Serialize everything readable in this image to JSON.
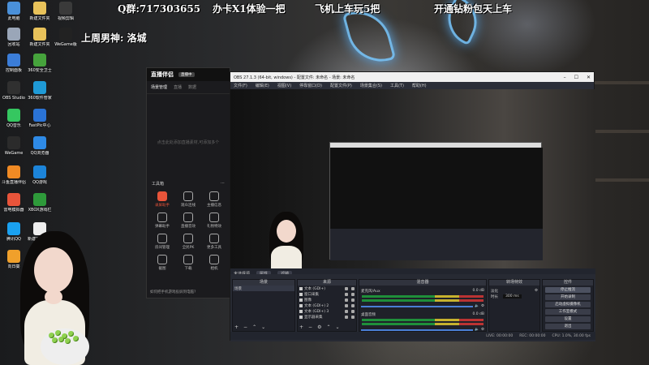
{
  "overlay": {
    "qq_group": "Q群:717303655",
    "promo1": "办卡X1体验一把",
    "promo2": "飞机上车玩5把",
    "promo3": "开通钻粉包天上车",
    "last_week": "上周男神: 洛城"
  },
  "desktop_icons": [
    {
      "label": "此电脑",
      "color": "#4a90d9"
    },
    {
      "label": "回收站",
      "color": "#9aa6b8"
    },
    {
      "label": "控制面板",
      "color": "#3b7dd8"
    },
    {
      "label": "OBS Studio",
      "color": "#303030"
    },
    {
      "label": "QQ音乐",
      "color": "#35c760"
    },
    {
      "label": "WeGame",
      "color": "#2b2b2b"
    },
    {
      "label": "斗鱼直播伴侣",
      "color": "#f08a24"
    },
    {
      "label": "雷电模拟器",
      "color": "#e8543a"
    },
    {
      "label": "腾讯QQ",
      "color": "#1aa1f0"
    },
    {
      "label": "向日葵",
      "color": "#f0a02b"
    },
    {
      "label": "新建文件夹",
      "color": "#e8c25a"
    },
    {
      "label": "新建文件夹",
      "color": "#e8c25a"
    },
    {
      "label": "360安全卫士",
      "color": "#46a33c"
    },
    {
      "label": "360软件管家",
      "color": "#1f9ad6"
    },
    {
      "label": "FastPic中心",
      "color": "#2a73d6"
    },
    {
      "label": "QQ浏览器",
      "color": "#2e8ae6"
    },
    {
      "label": "QQ游戏",
      "color": "#1c84d9"
    },
    {
      "label": "XBOX游戏栏",
      "color": "#2e9a3a"
    },
    {
      "label": "新建文本文档",
      "color": "#eeeeee"
    },
    {
      "label": "视频剪辑",
      "color": "#3a3a3a"
    },
    {
      "label": "WeGame版",
      "color": "#222222"
    }
  ],
  "companion": {
    "title": "直播伴侣",
    "badge": "直播中",
    "tabs": [
      "场景管理",
      "直播",
      "数据"
    ],
    "empty_text": "点击此处添加直播素材,可添加多个",
    "tools_title": "工具箱",
    "tools": [
      {
        "label": "录屏助手",
        "active": true
      },
      {
        "label": "观众连线",
        "active": false
      },
      {
        "label": "主播信息",
        "active": false
      },
      {
        "label": "弹幕助手",
        "active": false
      },
      {
        "label": "直播音效",
        "active": false
      },
      {
        "label": "礼物特效",
        "active": false
      },
      {
        "label": "房间管理",
        "active": false
      },
      {
        "label": "全民PK",
        "active": false
      },
      {
        "label": "更多工具",
        "active": false
      },
      {
        "label": "截图",
        "active": false
      },
      {
        "label": "下载",
        "active": false
      },
      {
        "label": "相机",
        "active": false
      }
    ],
    "footer": "如何把手机游戏投屏到电脑?"
  },
  "obs": {
    "title": "OBS 27.1.3 (64-bit, windows) - 配置文件: 未命名 - 场景: 未命名",
    "menus": [
      "文件(F)",
      "编辑(E)",
      "视图(V)",
      "停靠窗口(D)",
      "配置文件(P)",
      "场景集合(S)",
      "工具(T)",
      "帮助(H)"
    ],
    "scene_bar": {
      "label": "未选择源",
      "props": "属性",
      "filter": "滤镜"
    },
    "docks": {
      "scenes": "场景",
      "scene_item": "场景",
      "sources": "来源",
      "source_items": [
        "文本 (GDI+)",
        "窗口采集",
        "图像",
        "文本 (GDI+) 2",
        "文本 (GDI+) 3",
        "显示器采集"
      ],
      "mixer": "混音器",
      "mixer_items": [
        {
          "name": "麦克风/Aux",
          "db": "0.0 dB"
        },
        {
          "name": "桌面音频",
          "db": "0.0 dB"
        }
      ],
      "transitions": "转场特效",
      "transition_type": "淡化",
      "duration_label": "时长",
      "duration_value": "300 ms",
      "controls": "控件",
      "control_buttons": [
        "停止推流",
        "开始录制",
        "启动虚拟摄像机",
        "工作室模式",
        "设置",
        "退出"
      ]
    },
    "status": {
      "live": "LIVE: 00:00:00",
      "rec": "REC: 00:00:00",
      "cpu": "CPU: 1.0%, 30.00 fps"
    }
  },
  "colors": {
    "accent": "#e8543a",
    "obs_bg": "#2b2e38",
    "meter_green": "#1f8f3a"
  }
}
